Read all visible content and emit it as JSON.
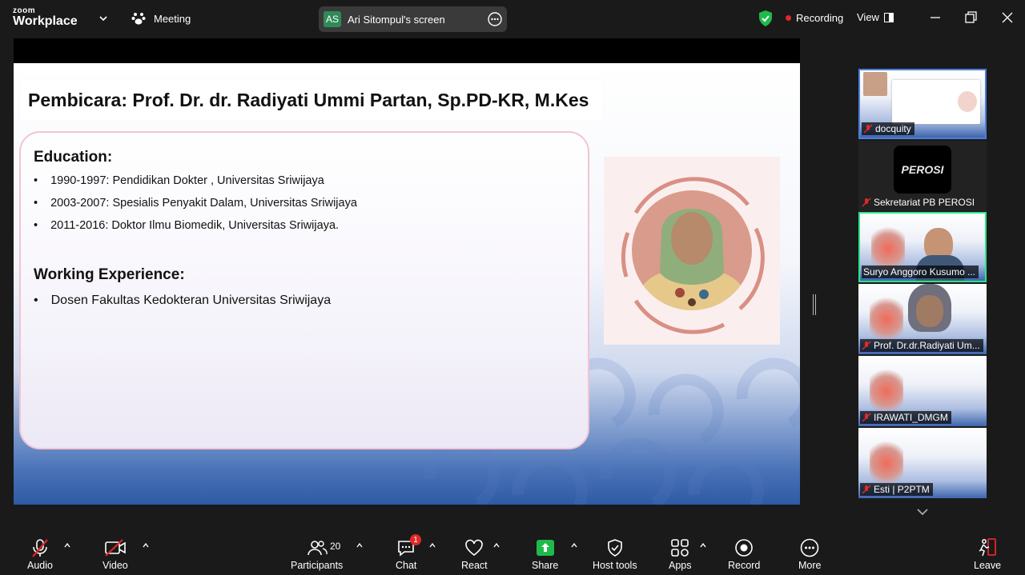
{
  "app": {
    "logo_small": "zoom",
    "logo_big": "Workplace",
    "meeting_label": "Meeting"
  },
  "share": {
    "initials": "AS",
    "screen_name": "Ari Sitompul's screen"
  },
  "status": {
    "recording": "Recording",
    "view": "View"
  },
  "slide": {
    "title": "Pembicara: Prof. Dr. dr. Radiyati Ummi Partan, Sp.PD-KR, M.Kes",
    "education_heading": "Education:",
    "education": [
      "1990-1997: Pendidikan Dokter , Universitas Sriwijaya",
      "2003-2007: Spesialis Penyakit Dalam, Universitas Sriwijaya",
      "2011-2016: Doktor Ilmu Biomedik, Universitas Sriwijaya."
    ],
    "work_heading": "Working Experience:",
    "work": [
      "Dosen Fakultas Kedokteran Universitas Sriwijaya"
    ],
    "bullet": "•"
  },
  "participants_strip": [
    {
      "name": "docquity",
      "kind": "slide-mini"
    },
    {
      "name": "Sekretariat PB PEROSI",
      "kind": "logo",
      "logo_text": "PEROSI"
    },
    {
      "name": "Suryo Anggoro Kusumo ...",
      "kind": "video-active"
    },
    {
      "name": "Prof. Dr.dr.Radiyati Um...",
      "kind": "video"
    },
    {
      "name": "IRAWATI_DMGM",
      "kind": "slide-mini"
    },
    {
      "name": "Esti | P2PTM",
      "kind": "slide-mini"
    }
  ],
  "toolbar": {
    "audio": "Audio",
    "video": "Video",
    "participants": "Participants",
    "participants_count": "20",
    "chat": "Chat",
    "chat_badge": "1",
    "react": "React",
    "share": "Share",
    "host_tools": "Host tools",
    "apps": "Apps",
    "record": "Record",
    "more": "More",
    "leave": "Leave"
  },
  "colors": {
    "accent_green": "#1fba4b",
    "record_red": "#e02828",
    "active_border": "#2ee28a",
    "slide_blue": "#2f5aa5"
  }
}
